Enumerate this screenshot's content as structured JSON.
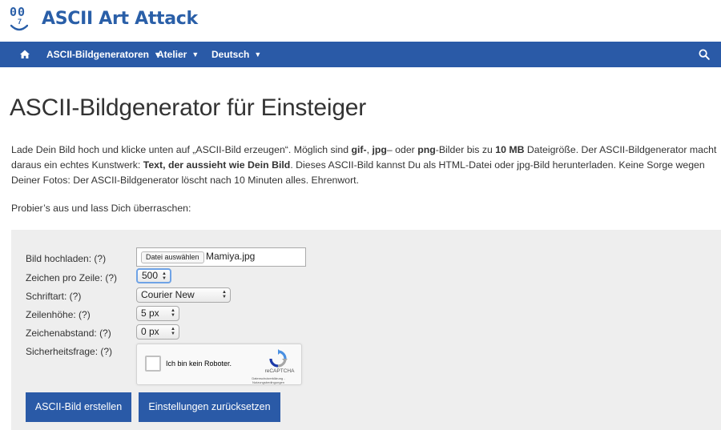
{
  "site": {
    "title": "ASCII Art Attack",
    "logo_eyes": "00",
    "logo_nose": "7"
  },
  "nav": {
    "home_icon": "home-icon",
    "items": [
      {
        "label": "ASCII-Bildgeneratoren"
      },
      {
        "label": "Atelier"
      },
      {
        "label": "Deutsch"
      }
    ],
    "search_icon": "search-icon"
  },
  "page": {
    "title": "ASCII-Bildgenerator für Einsteiger",
    "intro": {
      "p1a": "Lade Dein Bild hoch und klicke unten auf „ASCII-Bild erzeugen“. Möglich sind ",
      "gif": "gif-",
      "p1b": ", ",
      "jpg": "jpg",
      "p1c": "– oder ",
      "png": "png",
      "p1d": "-Bilder bis zu ",
      "size": "10 MB",
      "p1e": " Dateigröße. Der ASCII-Bildgenerator macht daraus ein echtes Kunstwerk: ",
      "emph": "Text, der aussieht wie Dein Bild",
      "p1f": ". Dieses ASCII-Bild kannst Du als HTML-Datei oder jpg-Bild herunterladen. Keine Sorge wegen Deiner Fotos: Der ASCII-Bildgenerator löscht nach 10 Minuten alles. Ehrenwort."
    },
    "probier": "Probier’s aus und lass Dich überraschen:"
  },
  "form": {
    "upload": {
      "label": "Bild hochladen: (?)",
      "button": "Datei auswählen",
      "file": "Mamiya.jpg"
    },
    "chars": {
      "label": "Zeichen pro Zeile: (?)",
      "value": "500"
    },
    "font": {
      "label": "Schriftart: (?)",
      "value": "Courier New"
    },
    "line_height": {
      "label": "Zeilenhöhe: (?)",
      "value": "5 px"
    },
    "spacing": {
      "label": "Zeichenabstand: (?)",
      "value": "0 px"
    },
    "captcha": {
      "label": "Sicherheitsfrage: (?)",
      "text": "Ich bin kein Roboter.",
      "brand": "reCAPTCHA",
      "links": "Datenschutzerklärung - Nutzungsbedingungen"
    },
    "submit": "ASCII-Bild erstellen",
    "reset": "Einstellungen zurücksetzen"
  },
  "colors": {
    "brand_blue": "#2a5aa7",
    "panel_bg": "#eeeeee"
  }
}
